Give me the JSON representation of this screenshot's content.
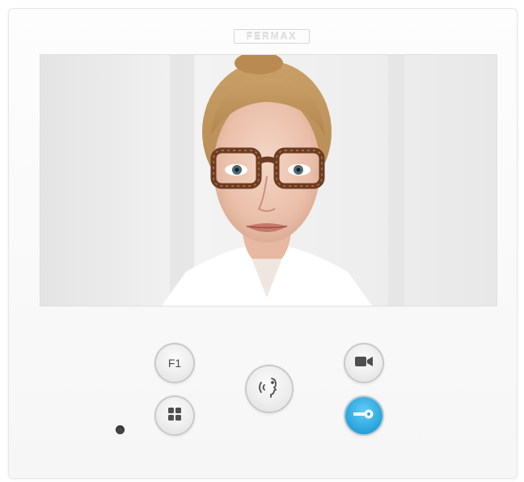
{
  "device": {
    "brand": "FERMAX",
    "colors": {
      "body": "#f7f7f7",
      "door_button": "#2aa6dc",
      "icon": "#4f4f4f"
    }
  },
  "screen": {
    "content": "video-feed"
  },
  "buttons": {
    "f1": {
      "label": "F1",
      "icon": "text-label"
    },
    "menu": {
      "icon": "grid-menu-icon"
    },
    "talk": {
      "icon": "speak-voice-icon"
    },
    "camera": {
      "icon": "video-camera-icon"
    },
    "door": {
      "icon": "key-icon"
    }
  },
  "indicator": {
    "icon": "status-led"
  }
}
